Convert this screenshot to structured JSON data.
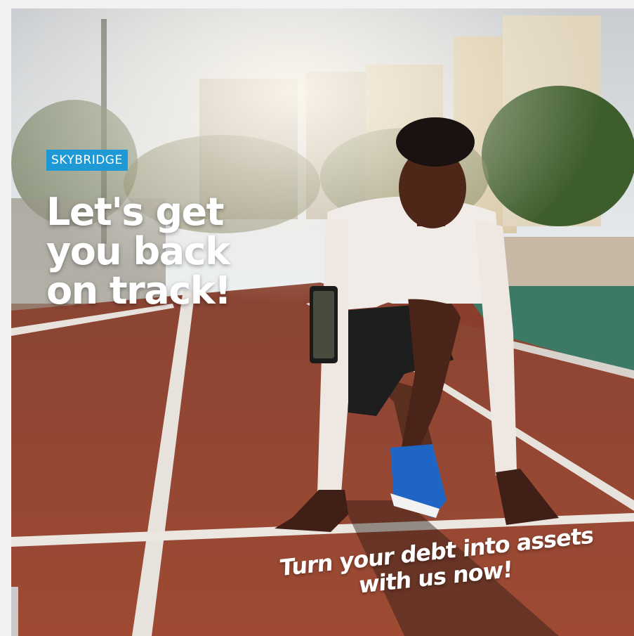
{
  "brand": {
    "label": "SKYBRIDGE",
    "color": "#1d9ad6"
  },
  "headline": {
    "line1": "Let's get",
    "line2": "you back",
    "line3": "on track!"
  },
  "tagline": {
    "line1": "Turn your debt into assets",
    "line2": "with us now!"
  },
  "scene": {
    "description_icon": "runner-on-track-photo",
    "track_color": "#9b4530",
    "lane_line_color": "#e8e2dc",
    "turf_color": "#3d7a66",
    "sky_color": "#e6ecef"
  }
}
